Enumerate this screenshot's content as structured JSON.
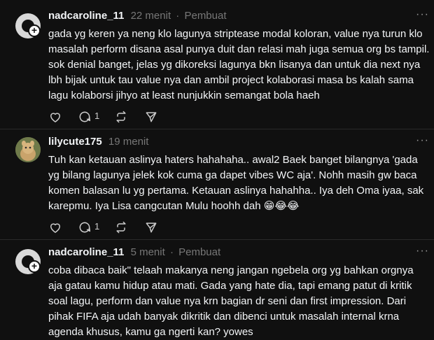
{
  "comments": [
    {
      "username": "nadcaroline_11",
      "time": "22 menit",
      "separator": "·",
      "badge": "Pembuat",
      "more": "···",
      "text": "gada yg keren ya neng klo lagunya striptease modal koloran, value nya turun klo masalah perform disana asal punya duit dan relasi mah juga semua org bs tampil. sok denial banget, jelas yg dikoreksi lagunya bkn lisanya dan untuk dia next nya lbh bijak untuk tau value nya dan ambil project kolaborasi masa bs kalah sama lagu kolaborsi jihyo at least nunjukkin semangat bola haeh",
      "reply_count": "1"
    },
    {
      "username": "lilycute175",
      "time": "19 menit",
      "more": "···",
      "text": "Tuh kan ketauan aslinya haters hahahaha.. awal2 Baek banget bilangnya 'gada yg bilang lagunya jelek kok cuma ga dapet vibes WC aja'. Nohh masih gw baca komen balasan lu yg pertama. Ketauan aslinya hahahha.. Iya deh Oma iyaa, sak karepmu. Iya Lisa cangcutan Mulu hoohh dah 😁😂😂",
      "reply_count": "1"
    },
    {
      "username": "nadcaroline_11",
      "time": "5 menit",
      "separator": "·",
      "badge": "Pembuat",
      "more": "···",
      "text": "coba dibaca baik\" telaah makanya neng jangan ngebela org yg bahkan orgnya aja gatau kamu hidup atau mati. Gada yang hate dia, tapi emang patut di kritik soal lagu, perform dan value nya krn bagian dr seni dan first impression. Dari pihak FIFA aja udah banyak dikritik dan dibenci untuk masalah internal krna agenda khusus, kamu ga ngerti kan? yowes"
    }
  ],
  "icons": {
    "like": "heart-icon",
    "reply": "comment-icon",
    "repost": "repost-icon",
    "share": "send-icon",
    "follow": "plus-icon"
  }
}
